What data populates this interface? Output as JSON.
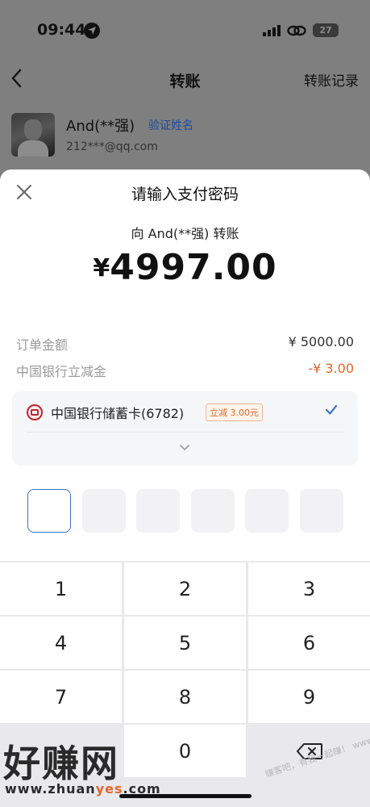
{
  "status_bar": {
    "time": "09:44",
    "battery": "27"
  },
  "nav": {
    "title": "转账",
    "records_label": "转账记录"
  },
  "payee": {
    "name": "And(**强)",
    "verify_label": "验证姓名",
    "email": "212***@qq.com"
  },
  "sheet": {
    "title": "请输入支付密码",
    "transfer_to": "向 And(**强) 转账",
    "currency": "¥",
    "amount": "4997.00",
    "order_label": "订单金额",
    "order_value": "¥ 5000.00",
    "discount_label": "中国银行立减金",
    "discount_value": "-¥ 3.00",
    "card_name": "中国银行储蓄卡(6782)",
    "card_tag": "立减 3.00元"
  },
  "password": {
    "length": 6,
    "entered": 0
  },
  "keypad": {
    "keys": [
      "1",
      "2",
      "3",
      "4",
      "5",
      "6",
      "7",
      "8",
      "9",
      "",
      "0",
      "delete"
    ]
  },
  "watermark": {
    "brand": "好赚网",
    "url_prefix": "www.zhuan",
    "url_accent": "yes",
    "url_suffix": ".com",
    "side": "赚客吧，有我一起赚！ www.zuanke8.com"
  },
  "colors": {
    "accent_blue": "#3a72c4",
    "discount_orange": "#e0672a",
    "boc_red": "#c8202c"
  }
}
